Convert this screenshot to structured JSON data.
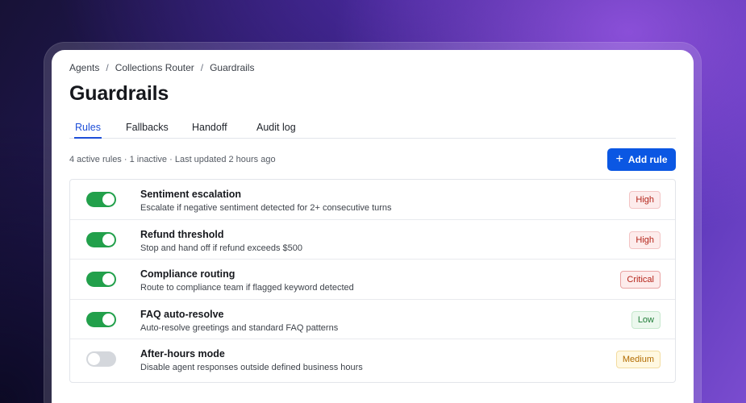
{
  "breadcrumb": [
    "Agents",
    "Collections Router",
    "Guardrails"
  ],
  "breadcrumb_separator": "/",
  "page_title": "Guardrails",
  "tabs": [
    {
      "label": "Rules",
      "active": true
    },
    {
      "label": "Fallbacks",
      "active": false
    },
    {
      "label": "Handoff",
      "active": false
    },
    {
      "label": "Audit log",
      "active": false
    }
  ],
  "meta_text": "4 active rules · 1 inactive · Last updated 2 hours ago",
  "add_rule_label": "Add rule",
  "rules": [
    {
      "title": "Sentiment escalation",
      "description": "Escalate if negative sentiment detected for 2+ consecutive turns",
      "enabled": true,
      "severity": "High",
      "severity_class": "high"
    },
    {
      "title": "Refund threshold",
      "description": "Stop and hand off if refund exceeds $500",
      "enabled": true,
      "severity": "High",
      "severity_class": "high"
    },
    {
      "title": "Compliance routing",
      "description": "Route to compliance team if flagged keyword detected",
      "enabled": true,
      "severity": "Critical",
      "severity_class": "critical"
    },
    {
      "title": "FAQ auto-resolve",
      "description": "Auto-resolve greetings and standard FAQ patterns",
      "enabled": true,
      "severity": "Low",
      "severity_class": "low"
    },
    {
      "title": "After-hours mode",
      "description": "Disable agent responses outside defined business hours",
      "enabled": false,
      "severity": "Medium",
      "severity_class": "medium"
    }
  ],
  "colors": {
    "accent": "#0b57e3",
    "toggle_on": "#22a04b",
    "toggle_off": "#d4d7dc"
  }
}
